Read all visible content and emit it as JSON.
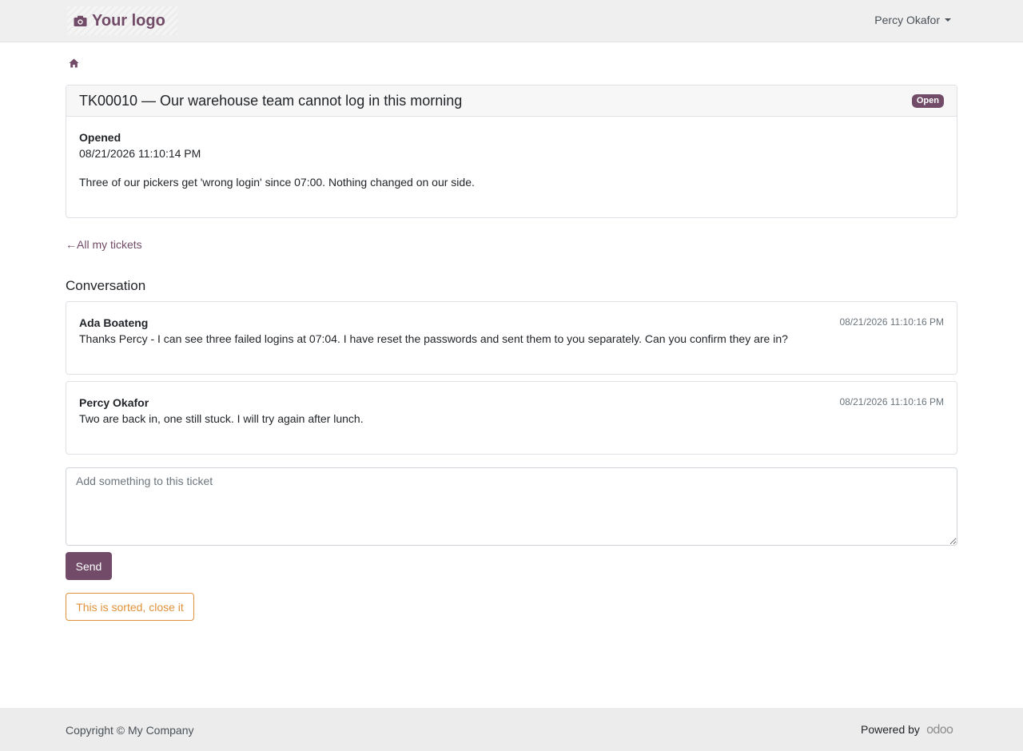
{
  "header": {
    "logo_text": "Your logo",
    "logo_icon": "camera-icon",
    "user_name": "Percy Okafor",
    "brand_color": "#714b67"
  },
  "breadcrumb": {
    "home_icon": "home-icon"
  },
  "ticket": {
    "title": "TK00010 — Our warehouse team cannot log in this morning",
    "status": "Open",
    "opened_label": "Opened",
    "opened_date": "08/21/2026 11:10:14 PM",
    "description": "Three of our pickers get 'wrong login' since 07:00. Nothing changed on our side."
  },
  "back_link": "All my tickets",
  "conversation": {
    "title": "Conversation",
    "messages": [
      {
        "author": "Ada Boateng",
        "date": "08/21/2026 11:10:16 PM",
        "body": "Thanks Percy - I can see three failed logins at 07:04. I have reset the passwords and sent them to you separately. Can you confirm they are in?"
      },
      {
        "author": "Percy Okafor",
        "date": "08/21/2026 11:10:16 PM",
        "body": "Two are back in, one still stuck. I will try again after lunch."
      }
    ]
  },
  "reply": {
    "placeholder": "Add something to this ticket",
    "value": "",
    "send_label": "Send",
    "close_label": "This is sorted, close it",
    "close_color": "#e0913b"
  },
  "footer": {
    "copyright": "Copyright © My Company",
    "powered_by": "Powered by",
    "powered_logo": "odoo"
  }
}
